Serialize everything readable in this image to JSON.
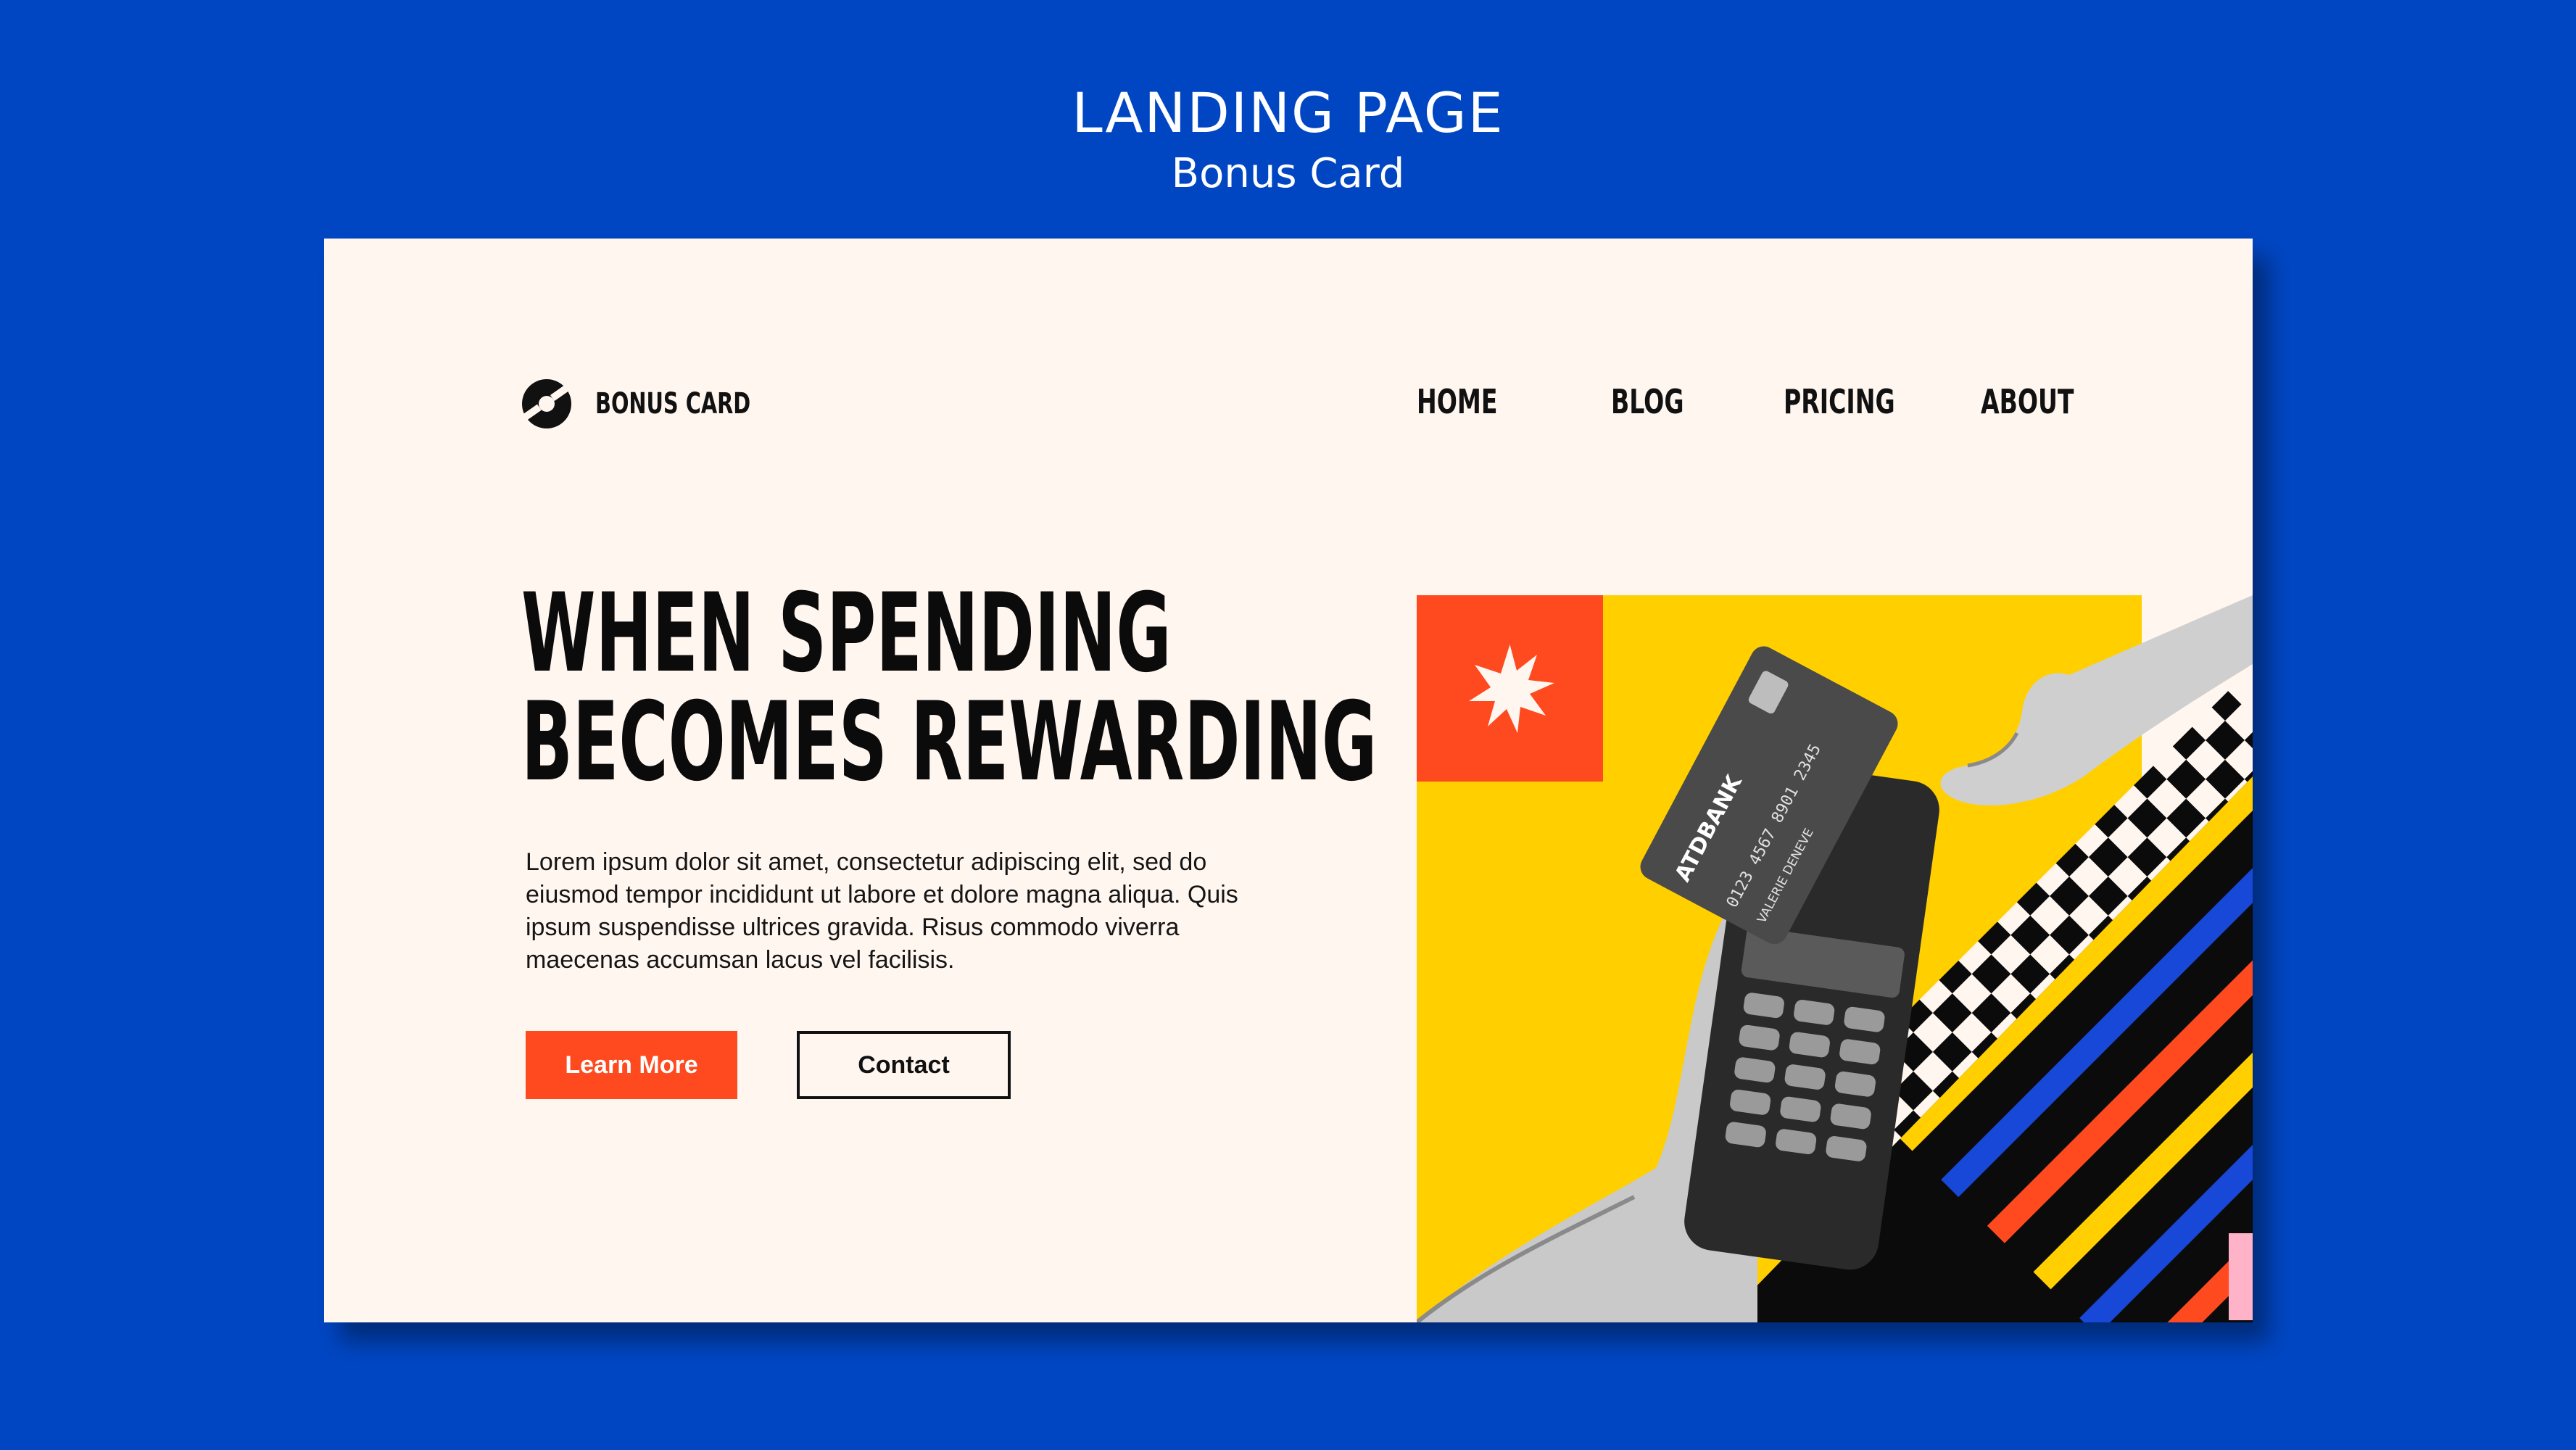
{
  "template_header": {
    "title": "LANDING PAGE",
    "subtitle": "Bonus Card"
  },
  "brand": {
    "name": "BONUS CARD",
    "logo_icon": "circular-logo-icon"
  },
  "nav": {
    "items": [
      {
        "label": "HOME"
      },
      {
        "label": "BLOG"
      },
      {
        "label": "PRICING"
      },
      {
        "label": "ABOUT"
      }
    ]
  },
  "hero": {
    "headline_line1": "WHEN SPENDING",
    "headline_line2": "BECOMES REWARDING",
    "body": "Lorem ipsum dolor sit amet, consectetur adipiscing elit, sed do eiusmod tempor incididunt ut labore et dolore magna aliqua. Quis ipsum suspendisse ultrices gravida. Risus commodo viverra maecenas accumsan lacus vel facilisis.",
    "primary_button": "Learn More",
    "secondary_button": "Contact"
  },
  "illustration": {
    "card_bank": "ATDBANK",
    "card_number": "0123 4567 8901 2345",
    "card_holder": "VALERIE DENEVE",
    "icons": [
      "starburst-icon",
      "credit-card-icon",
      "payment-terminal-icon"
    ]
  },
  "colors": {
    "page_background": "#0046c3",
    "mockup_background": "#fff6f0",
    "accent_orange": "#ff4a1f",
    "accent_yellow": "#ffcf00",
    "text_dark": "#111111"
  }
}
